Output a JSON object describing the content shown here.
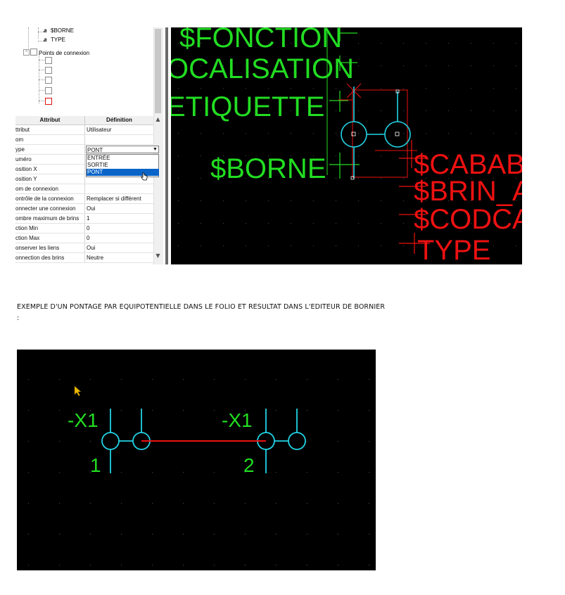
{
  "tree": {
    "items": [
      {
        "icon": "attribute-icon",
        "label": "$BORNE"
      },
      {
        "icon": "attribute-icon",
        "label": "TYPE"
      },
      {
        "icon": "folder-icon",
        "label": "Points de connexion"
      }
    ],
    "connection_points": [
      {
        "icon": "connection-point-icon",
        "state": "normal"
      },
      {
        "icon": "connection-point-icon",
        "state": "normal"
      },
      {
        "icon": "connection-point-icon",
        "state": "normal"
      },
      {
        "icon": "connection-point-icon",
        "state": "normal"
      },
      {
        "icon": "connection-point-icon",
        "state": "selected",
        "color": "#dd1111"
      }
    ]
  },
  "grid": {
    "headers": [
      "Attribut",
      "Définition"
    ],
    "rows": [
      {
        "attr": "ttribut",
        "value": "Utilisateur"
      },
      {
        "attr": "om",
        "value": ""
      },
      {
        "attr": "ype",
        "value": "PONT"
      },
      {
        "attr": "uméro",
        "value": "ENTRÉE"
      },
      {
        "attr": "osition X",
        "value": "SORTIE"
      },
      {
        "attr": "osition Y",
        "value": "PONT"
      },
      {
        "attr": "om de connexion",
        "value": ""
      },
      {
        "attr": "ontrôle de la connexion",
        "value": "Remplacer si différent"
      },
      {
        "attr": "onnecter une connexion",
        "value": "Oui"
      },
      {
        "attr": "ombre maximum de brins",
        "value": "1"
      },
      {
        "attr": "ction Min",
        "value": "0"
      },
      {
        "attr": "ction Max",
        "value": "0"
      },
      {
        "attr": "onserver les liens",
        "value": "Oui"
      },
      {
        "attr": "onnection des brins",
        "value": "Neutre"
      }
    ],
    "type_select": {
      "value": "PONT",
      "options": [
        "ENTRÉE",
        "SORTIE",
        "PONT"
      ],
      "selected": "PONT",
      "highlight_color": "#0a64c8"
    }
  },
  "cad_top": {
    "labels_green": [
      "$FONCTION",
      "OCALISATION",
      "ETIQUETTE",
      "$BORNE"
    ],
    "labels_red": [
      "$CABAB",
      "$BRIN_A",
      "$CODCA",
      "TYPE"
    ],
    "colors": {
      "green": "#22dd22",
      "red": "#ee1111",
      "cyan": "#22d4e6",
      "background": "#000000"
    }
  },
  "caption": {
    "line1": "EXEMPLE D'UN PONTAGE PAR EQUIPOTENTIELLE DANS LE FOLIO ET RESULTAT DANS L'EDITEUR DE BORNIER",
    "line2": ":"
  },
  "cad_bottom": {
    "terminals": [
      {
        "tag": "-X1",
        "number": "1"
      },
      {
        "tag": "-X1",
        "number": "2"
      }
    ],
    "colors": {
      "green": "#22dd22",
      "red": "#ee1111",
      "cyan": "#22d4e6",
      "cursor": "#e8b400"
    }
  }
}
